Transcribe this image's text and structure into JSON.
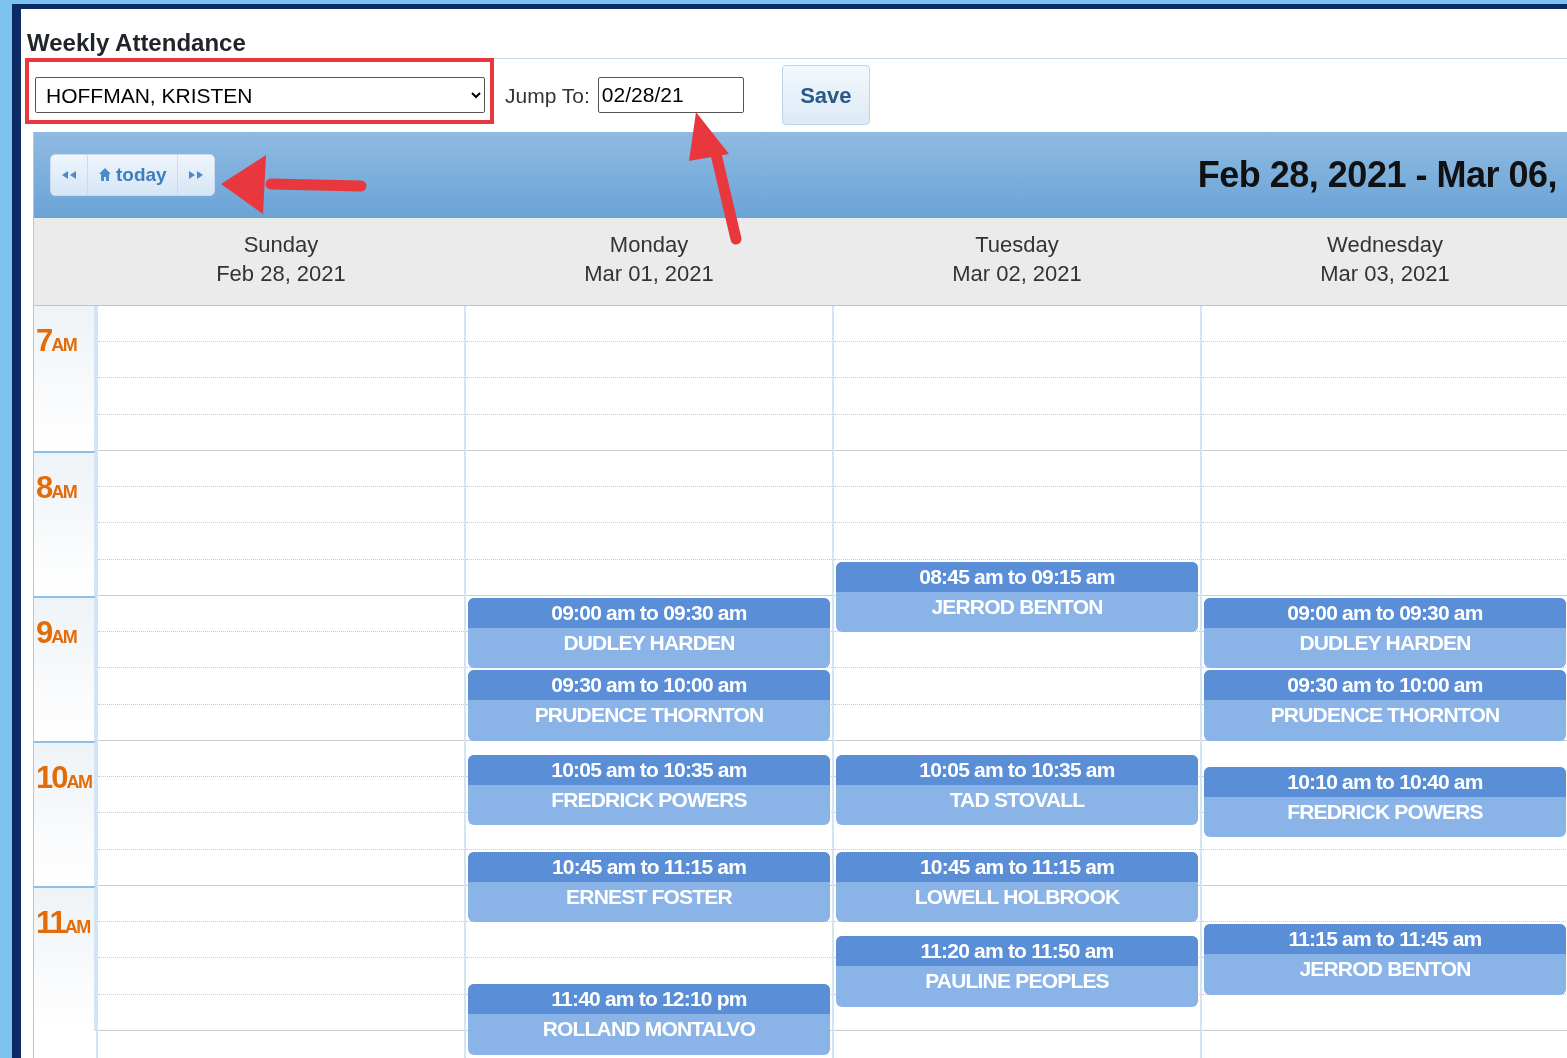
{
  "title": "Weekly Attendance",
  "student_select": {
    "value": "HOFFMAN, KRISTEN"
  },
  "jump_to": {
    "label": "Jump To:",
    "value": "02/28/21"
  },
  "save_button": "Save",
  "nav": {
    "today_label": "today"
  },
  "range_title": "Feb 28, 2021 - Mar 06,",
  "hours": [
    {
      "hour": "7",
      "suffix": "AM"
    },
    {
      "hour": "8",
      "suffix": "AM"
    },
    {
      "hour": "9",
      "suffix": "AM"
    },
    {
      "hour": "10",
      "suffix": "AM"
    },
    {
      "hour": "11",
      "suffix": "AM"
    }
  ],
  "days": [
    {
      "weekday": "Sunday",
      "date": "Feb 28, 2021"
    },
    {
      "weekday": "Monday",
      "date": "Mar 01, 2021",
      "events": [
        {
          "time": "09:00 am to 09:30 am",
          "name": "DUDLEY HARDEN"
        },
        {
          "time": "09:30 am to 10:00 am",
          "name": "PRUDENCE THORNTON"
        },
        {
          "time": "10:05 am to 10:35 am",
          "name": "FREDRICK POWERS"
        },
        {
          "time": "10:45 am to 11:15 am",
          "name": "ERNEST FOSTER"
        },
        {
          "time": "11:40 am to 12:10 pm",
          "name": "ROLLAND MONTALVO"
        }
      ]
    },
    {
      "weekday": "Tuesday",
      "date": "Mar 02, 2021",
      "events": [
        {
          "time": "08:45 am to 09:15 am",
          "name": "JERROD BENTON"
        },
        {
          "time": "10:05 am to 10:35 am",
          "name": "TAD STOVALL"
        },
        {
          "time": "10:45 am to 11:15 am",
          "name": "LOWELL HOLBROOK"
        },
        {
          "time": "11:20 am to 11:50 am",
          "name": "PAULINE PEOPLES"
        }
      ]
    },
    {
      "weekday": "Wednesday",
      "date": "Mar 03, 2021",
      "events": [
        {
          "time": "09:00 am to 09:30 am",
          "name": "DUDLEY HARDEN"
        },
        {
          "time": "09:30 am to 10:00 am",
          "name": "PRUDENCE THORNTON"
        },
        {
          "time": "10:10 am to 10:40 am",
          "name": "FREDRICK POWERS"
        },
        {
          "time": "11:15 am to 11:45 am",
          "name": "JERROD BENTON"
        }
      ]
    }
  ]
}
